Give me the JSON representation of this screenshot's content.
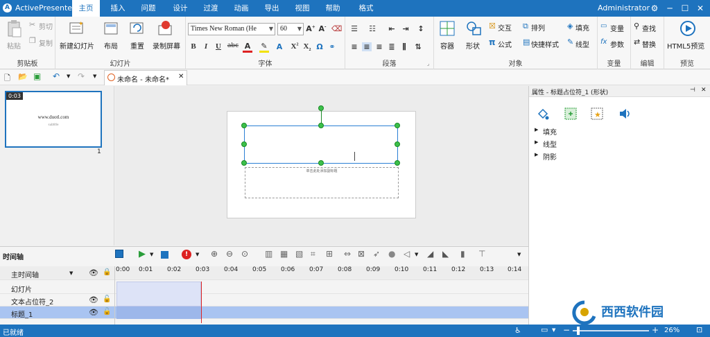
{
  "app": {
    "name": "ActivePresenter",
    "user": "Administrator"
  },
  "tabs": [
    "主页",
    "插入",
    "问题",
    "设计",
    "过渡",
    "动画",
    "导出",
    "视图",
    "帮助",
    "格式"
  ],
  "ribbon": {
    "clipboard": {
      "paste": "粘贴",
      "cut": "剪切",
      "copy": "复制",
      "label": "剪贴板"
    },
    "slides": {
      "new_slide": "新建幻灯片",
      "layout": "布局",
      "reset": "重置",
      "record": "录制屏幕",
      "label": "幻灯片"
    },
    "font": {
      "family": "Times New Roman (He",
      "size": "60",
      "label": "字体",
      "bold": "B",
      "italic": "I",
      "underline": "U",
      "strike": "abc",
      "color": "A",
      "omega": "Ω"
    },
    "paragraph": {
      "label": "段落"
    },
    "objects": {
      "container": "容器",
      "shape": "形状",
      "interaction": "交互",
      "arrange": "排列",
      "formula": "公式",
      "quick_style": "快捷样式",
      "fill": "填充",
      "line": "线型",
      "label": "对象"
    },
    "variables": {
      "variable": "变量",
      "params": "参数",
      "label": "变量"
    },
    "edit": {
      "find": "查找",
      "replace": "替换",
      "label": "编辑"
    },
    "preview": {
      "html5": "HTML5预览",
      "label": "预览"
    }
  },
  "document_tab": "未命名 - 未命名*",
  "slide_thumb": {
    "time": "0:03",
    "number": "1",
    "title": "www.duotl.com",
    "sub": "subtitle"
  },
  "slide": {
    "subtitle_placeholder": "单击此处添加副标题"
  },
  "properties": {
    "title": "属性 - 标题占位符_1 (形状)",
    "sections": [
      "填充",
      "线型",
      "阴影"
    ]
  },
  "timeline": {
    "title": "时间轴",
    "main_timeline": "主时间轴",
    "ticks": [
      "0:00",
      "0:01",
      "0:02",
      "0:03",
      "0:04",
      "0:05",
      "0:06",
      "0:07",
      "0:08",
      "0:09",
      "0:10",
      "0:11",
      "0:12",
      "0:13",
      "0:14"
    ],
    "tracks": [
      "幻灯片",
      "文本占位符_2",
      "标题_1"
    ]
  },
  "status": {
    "text": "已就绪",
    "zoom": "26%"
  },
  "watermark": "西西软件园",
  "colors": {
    "accent": "#1e73be",
    "handle": "#3cc04a",
    "selection": "#a9c4f1"
  }
}
